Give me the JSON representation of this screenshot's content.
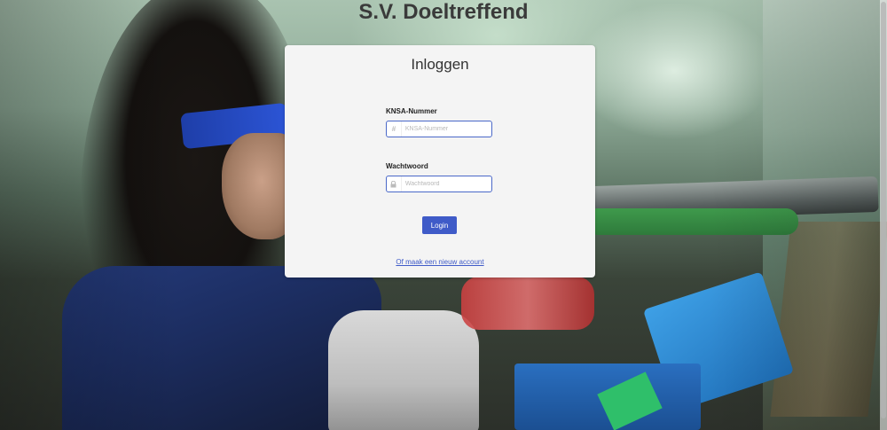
{
  "site": {
    "title": "S.V. Doeltreffend"
  },
  "login": {
    "heading": "Inloggen",
    "knsa_label": "KNSA-Nummer",
    "knsa_placeholder": "KNSA-Nummer",
    "knsa_value": "",
    "knsa_icon": "hash-icon",
    "password_label": "Wachtwoord",
    "password_placeholder": "Wachtwoord",
    "password_value": "",
    "password_icon": "lock-icon",
    "submit_label": "Login",
    "register_link": "Of maak een nieuw account"
  },
  "colors": {
    "accent": "#3f5bc8",
    "card_bg": "#f4f4f4",
    "title_text": "#3a3a3a"
  }
}
